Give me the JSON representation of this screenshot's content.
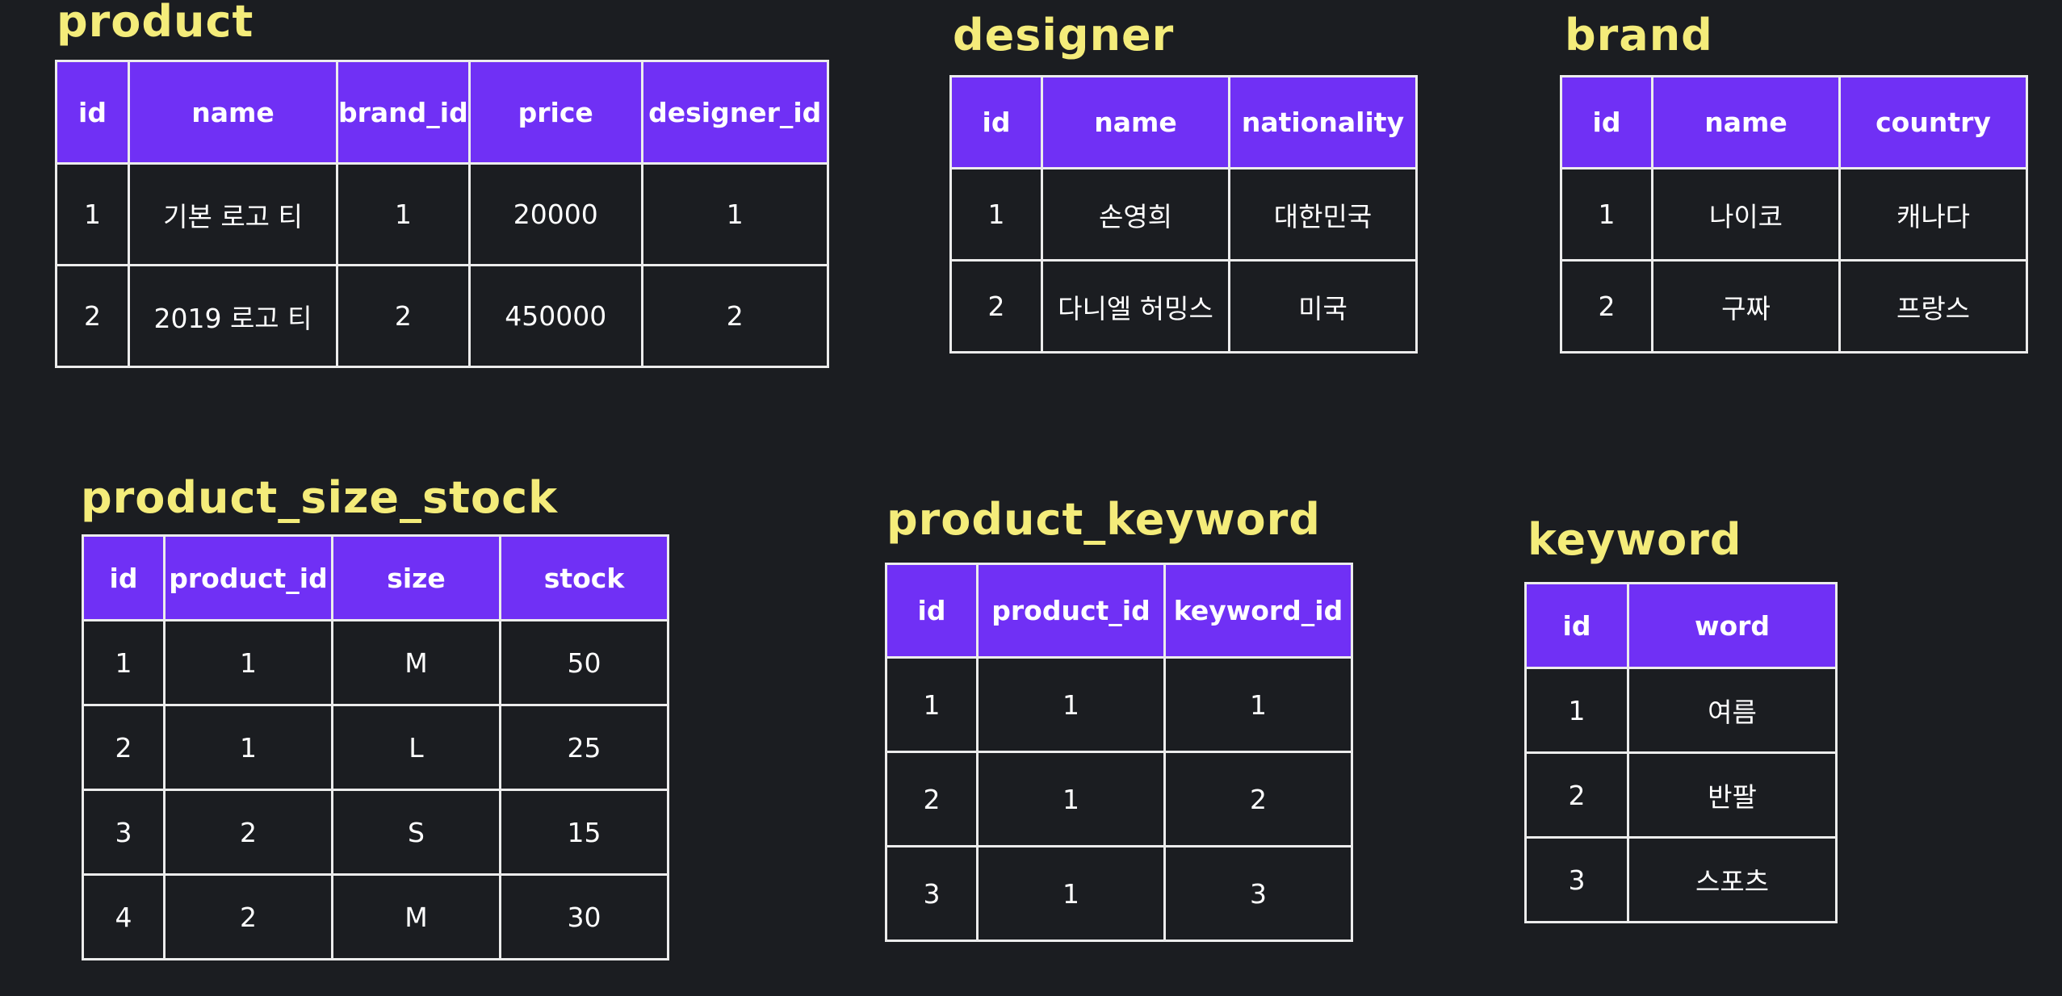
{
  "tables": [
    {
      "title": "product",
      "columns": [
        "id",
        "name",
        "brand_id",
        "price",
        "designer_id"
      ],
      "rows": [
        [
          "1",
          "기본 로고 티",
          "1",
          "20000",
          "1"
        ],
        [
          "2",
          "2019 로고 티",
          "2",
          "450000",
          "2"
        ]
      ]
    },
    {
      "title": "designer",
      "columns": [
        "id",
        "name",
        "nationality"
      ],
      "rows": [
        [
          "1",
          "손영희",
          "대한민국"
        ],
        [
          "2",
          "다니엘 허밍스",
          "미국"
        ]
      ]
    },
    {
      "title": "brand",
      "columns": [
        "id",
        "name",
        "country"
      ],
      "rows": [
        [
          "1",
          "나이코",
          "캐나다"
        ],
        [
          "2",
          "구짜",
          "프랑스"
        ]
      ]
    },
    {
      "title": "product_size_stock",
      "columns": [
        "id",
        "product_id",
        "size",
        "stock"
      ],
      "rows": [
        [
          "1",
          "1",
          "M",
          "50"
        ],
        [
          "2",
          "1",
          "L",
          "25"
        ],
        [
          "3",
          "2",
          "S",
          "15"
        ],
        [
          "4",
          "2",
          "M",
          "30"
        ]
      ]
    },
    {
      "title": "product_keyword",
      "columns": [
        "id",
        "product_id",
        "keyword_id"
      ],
      "rows": [
        [
          "1",
          "1",
          "1"
        ],
        [
          "2",
          "1",
          "2"
        ],
        [
          "3",
          "1",
          "3"
        ]
      ]
    },
    {
      "title": "keyword",
      "columns": [
        "id",
        "word"
      ],
      "rows": [
        [
          "1",
          "여름"
        ],
        [
          "2",
          "반팔"
        ],
        [
          "3",
          "스포츠"
        ]
      ]
    }
  ],
  "colors": {
    "background": "#1b1d21",
    "header": "#7030f5",
    "title": "#f4ec7a",
    "border": "#ececec"
  }
}
